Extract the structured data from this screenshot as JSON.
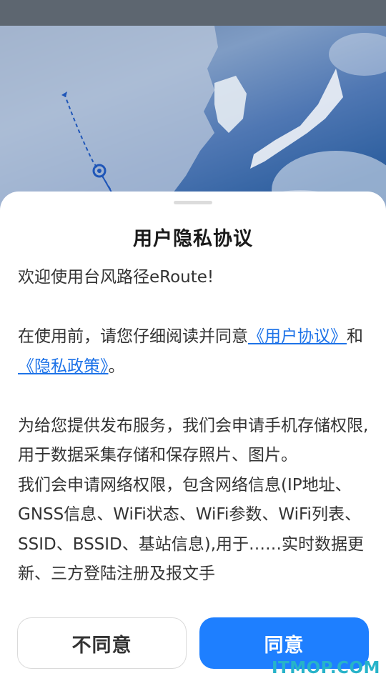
{
  "dialog": {
    "title": "用户隐私协议",
    "welcome": "欢迎使用台风路径eRoute!",
    "intro_prefix": "在使用前，请您仔细阅读并同意",
    "user_agreement_link": "《用户协议》",
    "and": "和",
    "privacy_policy_link": "《隐私政策》",
    "intro_suffix": "。",
    "storage_permission": "为给您提供发布服务，我们会申请手机存储权限, 用于数据采集存储和保存照片、图片。",
    "network_permission": "我们会申请网络权限，包含网络信息(IP地址、GNSS信息、WiFi状态、WiFi参数、WiFi列表、SSID、BSSID、基站信息),用于……实时数据更新、三方登陆注册及报文手"
  },
  "buttons": {
    "disagree": "不同意",
    "agree": "同意"
  },
  "watermark": "ITMOP.COM",
  "colors": {
    "accent": "#1e7fff",
    "link": "#1e73e8",
    "watermark": "#27b3c9"
  }
}
